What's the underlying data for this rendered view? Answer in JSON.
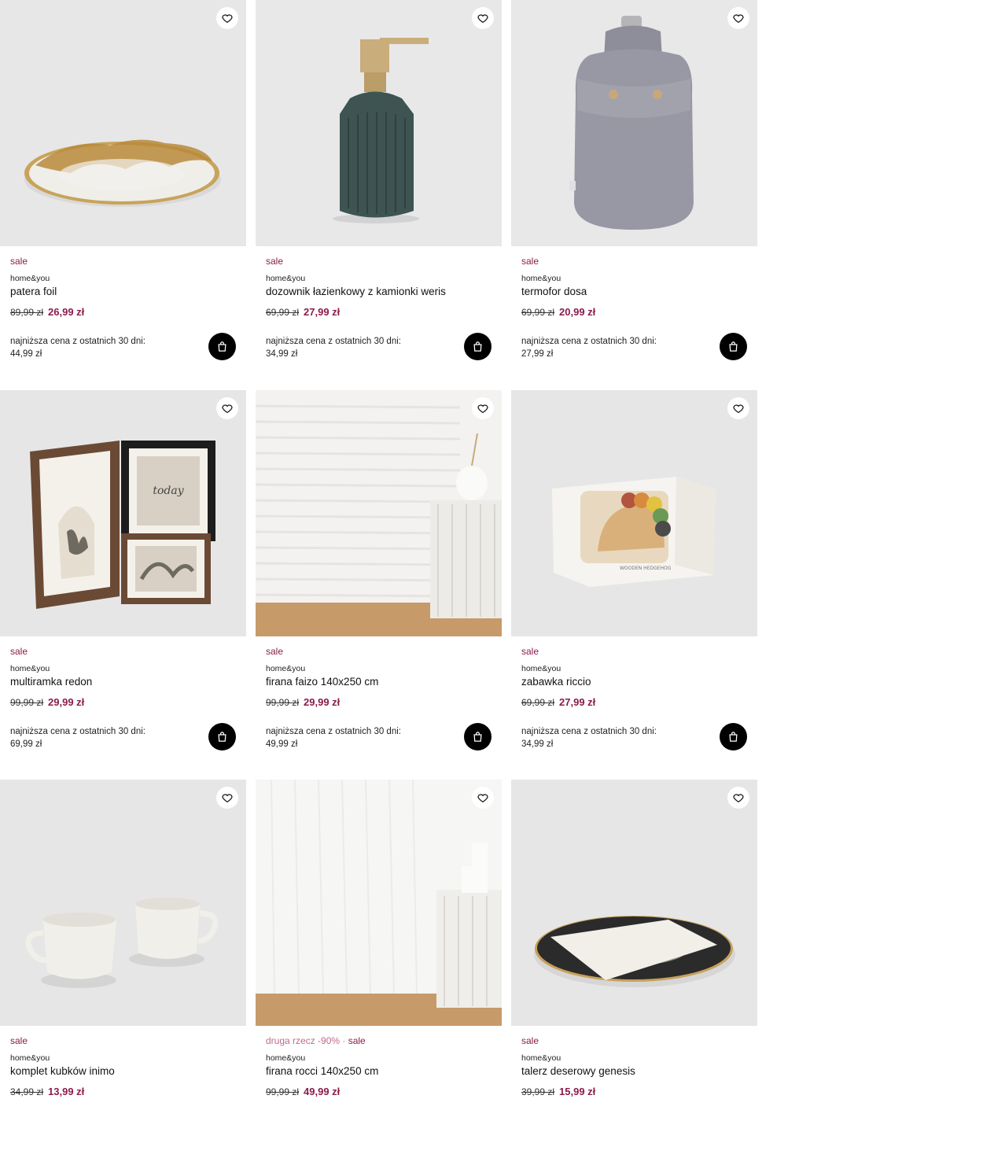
{
  "lowest_price_label": "najniższa cena z ostatnich 30 dni:",
  "products": [
    {
      "tag": "sale",
      "promo": "",
      "brand": "home&you",
      "title": "patera foil",
      "old_price": "89,99 zł",
      "new_price": "26,99 zł",
      "lowest_price": "44,99 zł",
      "image": "plate-gold-foil"
    },
    {
      "tag": "sale",
      "promo": "",
      "brand": "home&you",
      "title": "dozownik łazienkowy z kamionki weris",
      "old_price": "69,99 zł",
      "new_price": "27,99 zł",
      "lowest_price": "34,99 zł",
      "image": "soap-dispenser"
    },
    {
      "tag": "sale",
      "promo": "",
      "brand": "home&you",
      "title": "termofor dosa",
      "old_price": "69,99 zł",
      "new_price": "20,99 zł",
      "lowest_price": "27,99 zł",
      "image": "hot-water-bottle"
    },
    {
      "tag": "sale",
      "promo": "",
      "brand": "home&you",
      "title": "multiramka redon",
      "old_price": "99,99 zł",
      "new_price": "29,99 zł",
      "lowest_price": "69,99 zł",
      "image": "photo-frames"
    },
    {
      "tag": "sale",
      "promo": "",
      "brand": "home&you",
      "title": "firana faizo 140x250 cm",
      "old_price": "99,99 zł",
      "new_price": "29,99 zł",
      "lowest_price": "49,99 zł",
      "image": "curtain-striped"
    },
    {
      "tag": "sale",
      "promo": "",
      "brand": "home&you",
      "title": "zabawka riccio",
      "old_price": "69,99 zł",
      "new_price": "27,99 zł",
      "lowest_price": "34,99 zł",
      "image": "wooden-hedgehog-box"
    },
    {
      "tag": "sale",
      "promo": "",
      "brand": "home&you",
      "title": "komplet kubków inimo",
      "old_price": "34,99 zł",
      "new_price": "13,99 zł",
      "lowest_price": "",
      "image": "mugs"
    },
    {
      "tag": "sale",
      "promo": "druga rzecz -90% · ",
      "brand": "home&you",
      "title": "firana rocci 140x250 cm",
      "old_price": "99,99 zł",
      "new_price": "49,99 zł",
      "lowest_price": "",
      "image": "curtain-white"
    },
    {
      "tag": "sale",
      "promo": "",
      "brand": "home&you",
      "title": "talerz deserowy genesis",
      "old_price": "39,99 zł",
      "new_price": "15,99 zł",
      "lowest_price": "",
      "image": "dessert-plate"
    }
  ],
  "colors": {
    "sale": "#8b1c4a",
    "promo": "#c06a8f",
    "image_bg": "#e6e6e7"
  },
  "icons": {
    "wishlist": "heart-icon",
    "cart": "shopping-bag-icon"
  }
}
